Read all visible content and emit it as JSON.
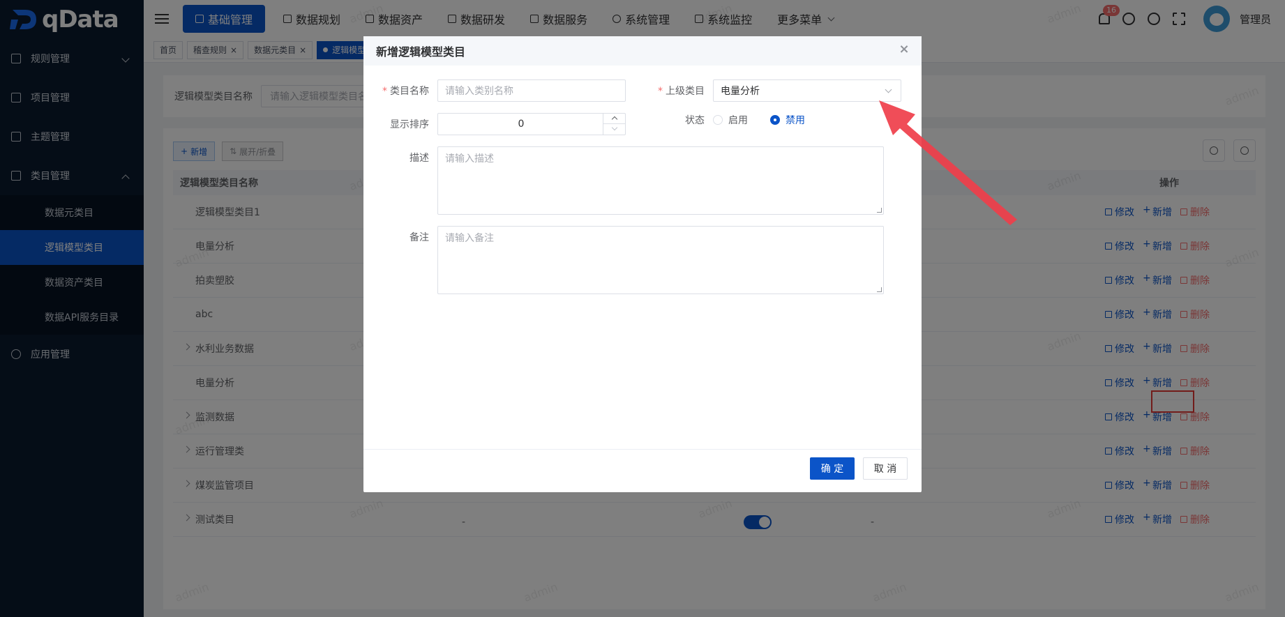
{
  "app": {
    "logo_text": "qData"
  },
  "sidebar": {
    "items": [
      {
        "label": "规则管理",
        "expanded": false
      },
      {
        "label": "项目管理"
      },
      {
        "label": "主题管理"
      },
      {
        "label": "类目管理",
        "expanded": true
      }
    ],
    "sub_items": [
      {
        "label": "数据元类目",
        "active": false
      },
      {
        "label": "逻辑模型类目",
        "active": true
      },
      {
        "label": "数据资产类目",
        "active": false
      },
      {
        "label": "数据API服务目录",
        "active": false
      }
    ],
    "after_items": [
      {
        "label": "应用管理"
      }
    ]
  },
  "topnav": {
    "items": [
      {
        "label": "基础管理",
        "active": true
      },
      {
        "label": "数据规划"
      },
      {
        "label": "数据资产"
      },
      {
        "label": "数据研发"
      },
      {
        "label": "数据服务"
      },
      {
        "label": "系统管理"
      },
      {
        "label": "系统监控"
      },
      {
        "label": "更多菜单"
      }
    ],
    "notification_count": "16",
    "username": "管理员"
  },
  "tags": [
    {
      "label": "首页",
      "closable": false,
      "active": false
    },
    {
      "label": "稽查规则",
      "closable": true,
      "active": false
    },
    {
      "label": "数据元类目",
      "closable": true,
      "active": false
    },
    {
      "label": "逻辑模型",
      "closable": false,
      "active": true
    }
  ],
  "search": {
    "label": "逻辑模型类目名称",
    "placeholder": "请输入逻辑模型类目名"
  },
  "toolbar": {
    "add_label": "新增",
    "expand_label": "展开/折叠"
  },
  "table": {
    "columns": {
      "name": "逻辑模型类目名称",
      "ops": "操作"
    },
    "op_labels": {
      "edit": "修改",
      "add": "新增",
      "delete": "删除"
    },
    "rows": [
      {
        "name": "逻辑模型类目1",
        "expandable": false
      },
      {
        "name": "电量分析",
        "expandable": false
      },
      {
        "name": "拍卖塑胶",
        "expandable": false
      },
      {
        "name": "abc",
        "expandable": false
      },
      {
        "name": "水利业务数据",
        "expandable": true
      },
      {
        "name": "电量分析",
        "expandable": false
      },
      {
        "name": "监测数据",
        "expandable": true
      },
      {
        "name": "运行管理类",
        "expandable": true
      },
      {
        "name": "煤炭监管项目",
        "expandable": true
      },
      {
        "name": "测试类目",
        "expandable": true,
        "col2": "-",
        "col4": "-",
        "status_on": true
      }
    ]
  },
  "watermark": "admin",
  "dialog": {
    "title": "新增逻辑模型类目",
    "close_symbol": "×",
    "fields": {
      "name_label": "类目名称",
      "name_placeholder": "请输入类别名称",
      "parent_label": "上级类目",
      "parent_value": "电量分析",
      "sort_label": "显示排序",
      "sort_value": "0",
      "status_label": "状态",
      "status_options": [
        "启用",
        "禁用"
      ],
      "status_selected": "禁用",
      "desc_label": "描述",
      "desc_placeholder": "请输入描述",
      "remark_label": "备注",
      "remark_placeholder": "请输入备注"
    },
    "confirm_label": "确 定",
    "cancel_label": "取 消"
  },
  "colors": {
    "primary": "#0b54c8",
    "danger": "#f56c6c",
    "sidebar_bg": "#0b1a2e",
    "annotation_red": "#e53935"
  }
}
